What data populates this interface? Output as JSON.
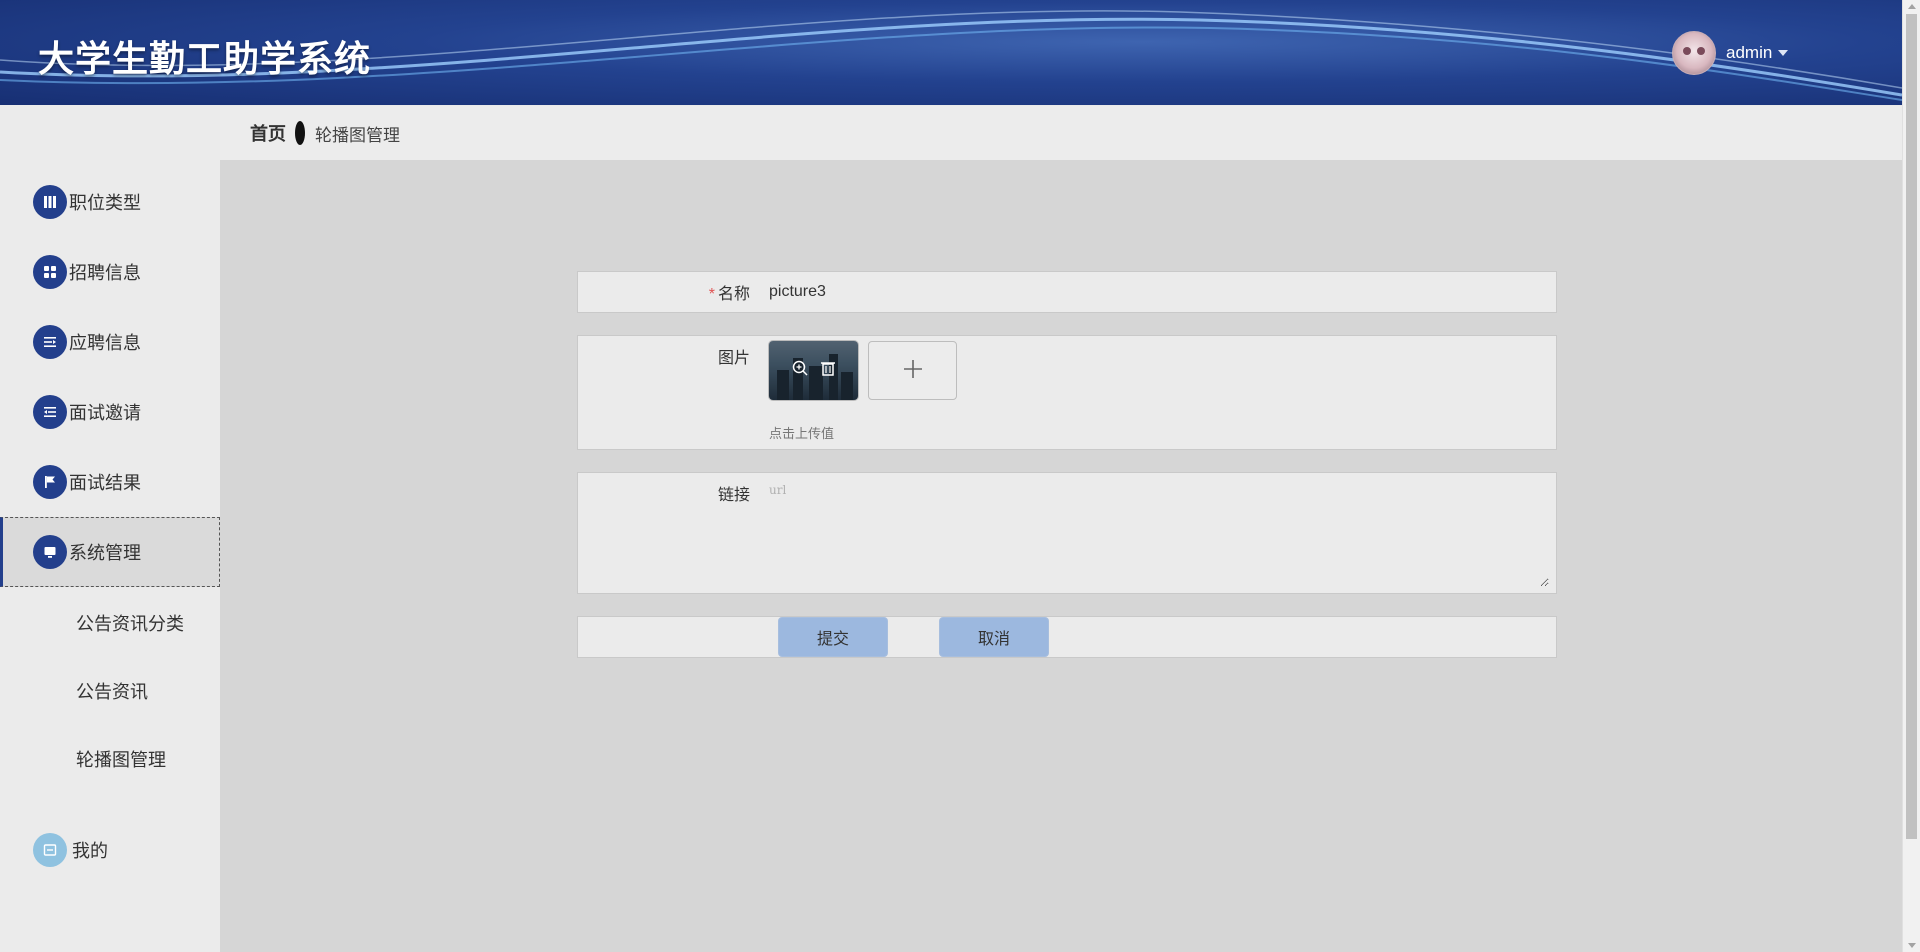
{
  "header": {
    "app_title": "大学生勤工助学系统",
    "username": "admin",
    "accent": "#233f8c"
  },
  "breadcrumb": {
    "home": "首页",
    "current": "轮播图管理"
  },
  "sidebar": {
    "items": [
      {
        "label": "职位类型",
        "icon": "book-icon"
      },
      {
        "label": "招聘信息",
        "icon": "grid-icon"
      },
      {
        "label": "应聘信息",
        "icon": "list-indent-icon"
      },
      {
        "label": "面试邀请",
        "icon": "list-outdent-icon"
      },
      {
        "label": "面试结果",
        "icon": "flag-icon"
      },
      {
        "label": "系统管理",
        "icon": "monitor-icon",
        "active": true
      }
    ],
    "sub_items": [
      {
        "label": "公告资讯分类"
      },
      {
        "label": "公告资讯"
      },
      {
        "label": "轮播图管理"
      }
    ],
    "mine": {
      "label": "我的",
      "icon": "user-panel-icon"
    }
  },
  "form": {
    "name_label": "名称",
    "name_required": "*",
    "name_value": "picture3",
    "image_label": "图片",
    "upload_hint": "点击上传值",
    "link_label": "链接",
    "link_placeholder": "url",
    "submit_label": "提交",
    "cancel_label": "取消"
  }
}
